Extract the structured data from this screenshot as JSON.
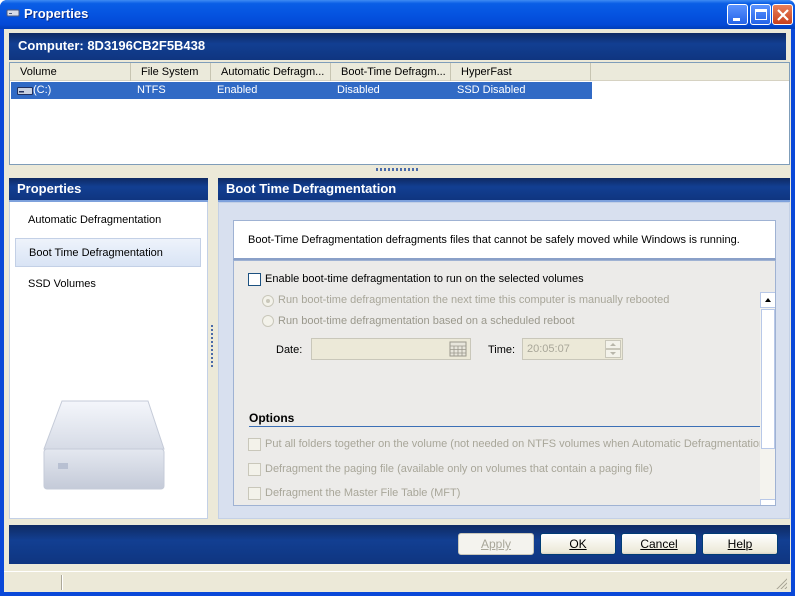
{
  "window": {
    "title": "Properties"
  },
  "computer": {
    "label": "Computer: 8D3196CB2F5B438"
  },
  "volume_list": {
    "columns": [
      "Volume",
      "File System",
      "Automatic Defragm...",
      "Boot-Time Defragm...",
      "HyperFast"
    ],
    "rows": [
      {
        "volume": "(C:)",
        "file_system": "NTFS",
        "automatic": "Enabled",
        "boot_time": "Disabled",
        "hyperfast": "SSD Disabled"
      }
    ]
  },
  "left_panel": {
    "title": "Properties",
    "items": [
      "Automatic Defragmentation",
      "Boot Time Defragmentation",
      "SSD Volumes"
    ],
    "selected_index": 1
  },
  "right_panel": {
    "title": "Boot Time Defragmentation",
    "description": "Boot-Time Defragmentation defragments files that cannot be safely moved while Windows is running.",
    "enable_label": "Enable boot-time defragmentation to run on the selected volumes",
    "radio_next_reboot": "Run boot-time defragmentation the next time this computer is manually rebooted",
    "radio_scheduled": "Run boot-time defragmentation based on a scheduled reboot",
    "date_label": "Date:",
    "date_value": "",
    "time_label": "Time:",
    "time_value": "20:05:07",
    "options_title": "Options",
    "options": [
      "Put all folders together on the volume (not needed on NTFS volumes when Automatic Defragmentation is",
      "Defragment the paging file (available only on volumes that contain a paging file)",
      "Defragment the Master File Table (MFT)"
    ]
  },
  "buttons": {
    "apply": "Apply",
    "ok": "OK",
    "cancel": "Cancel",
    "help": "Help"
  },
  "colors": {
    "header_blue": "#123f92",
    "selection_blue": "#316ac5",
    "titlebar_blue": "#0553e0"
  }
}
